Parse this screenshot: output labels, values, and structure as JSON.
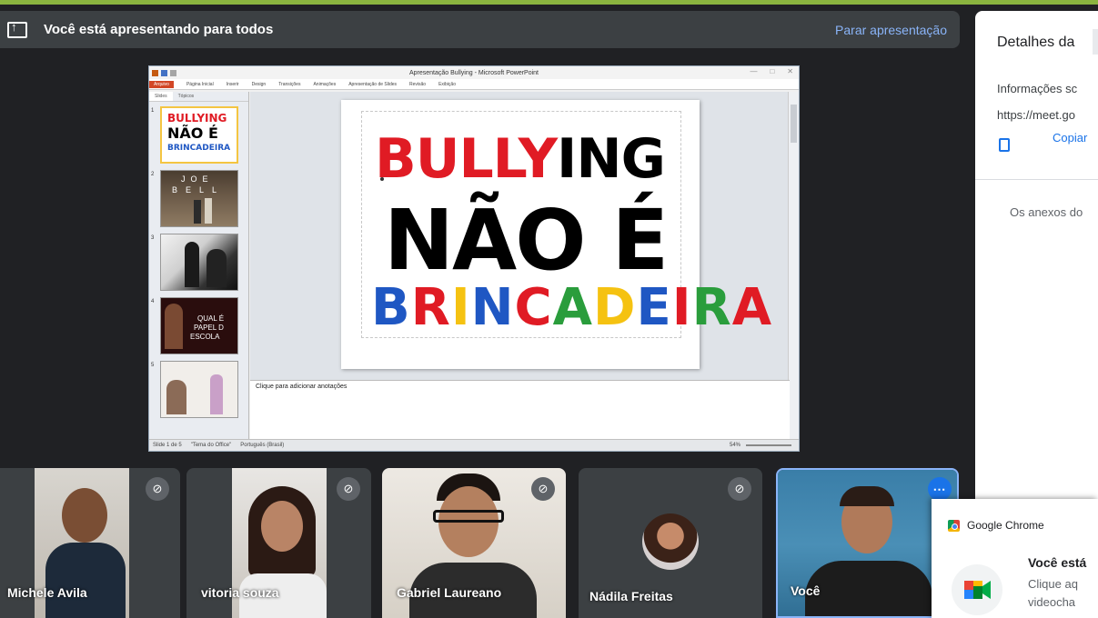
{
  "banner": {
    "text": "Você está apresentando para todos",
    "stop_label": "Parar apresentação"
  },
  "powerpoint": {
    "window_title": "Apresentação Bullying - Microsoft PowerPoint",
    "ribbon_tabs": [
      "Arquivo",
      "Página Inicial",
      "Inserir",
      "Design",
      "Transições",
      "Animações",
      "Apresentação de Slides",
      "Revisão",
      "Exibição"
    ],
    "pane_tabs": [
      "Slides",
      "Tópicos"
    ],
    "thumbnails": [
      {
        "number": "1",
        "caption_lines": [
          "BULLYING",
          "NÃO É",
          "BRINCADEIRA"
        ]
      },
      {
        "number": "2",
        "caption_lines": [
          "JOE",
          "BELL"
        ]
      },
      {
        "number": "3",
        "caption_lines": []
      },
      {
        "number": "4",
        "caption_lines": [
          "QUAL É",
          "PAPEL D",
          "ESCOLA"
        ]
      },
      {
        "number": "5",
        "caption_lines": []
      }
    ],
    "slide": {
      "line1_red": "BULLY",
      "line1_black": "ING",
      "line2": "NÃO É",
      "line3_letters": [
        "B",
        "R",
        "I",
        "N",
        "C",
        "A",
        "D",
        "E",
        "I",
        "R",
        "A"
      ],
      "line3_colors": [
        "#1f57c3",
        "#e01b24",
        "#f5c211",
        "#1f57c3",
        "#e01b24",
        "#2a9d3c",
        "#f5c211",
        "#1f57c3",
        "#e01b24",
        "#2a9d3c",
        "#e01b24"
      ]
    },
    "notes_placeholder": "Clique para adicionar anotações",
    "status": {
      "slide_counter": "Slide 1 de 5",
      "theme": "\"Tema do Office\"",
      "language": "Português (Brasil)",
      "zoom": "54%"
    }
  },
  "side_panel": {
    "title": "Detalhes da",
    "info_label": "Informações sc",
    "url": "https://meet.go",
    "copy_label": "Copiar",
    "attachments_text": "Os anexos do"
  },
  "participants": [
    {
      "name": "Michele Avila",
      "muted": true
    },
    {
      "name": "vitoria souza",
      "muted": true
    },
    {
      "name": "Gabriel Laureano",
      "muted": true
    },
    {
      "name": "Nádila Freitas",
      "muted": true
    },
    {
      "name": "Você",
      "muted": false
    }
  ],
  "notification": {
    "app": "Google Chrome",
    "title": "Você está",
    "body_line1": "Clique aq",
    "body_line2": "videocha"
  },
  "colors": {
    "accent_blue": "#1a73e8",
    "banner_bg": "#3c4043",
    "background": "#202124",
    "bullying_red": "#e01b24"
  }
}
